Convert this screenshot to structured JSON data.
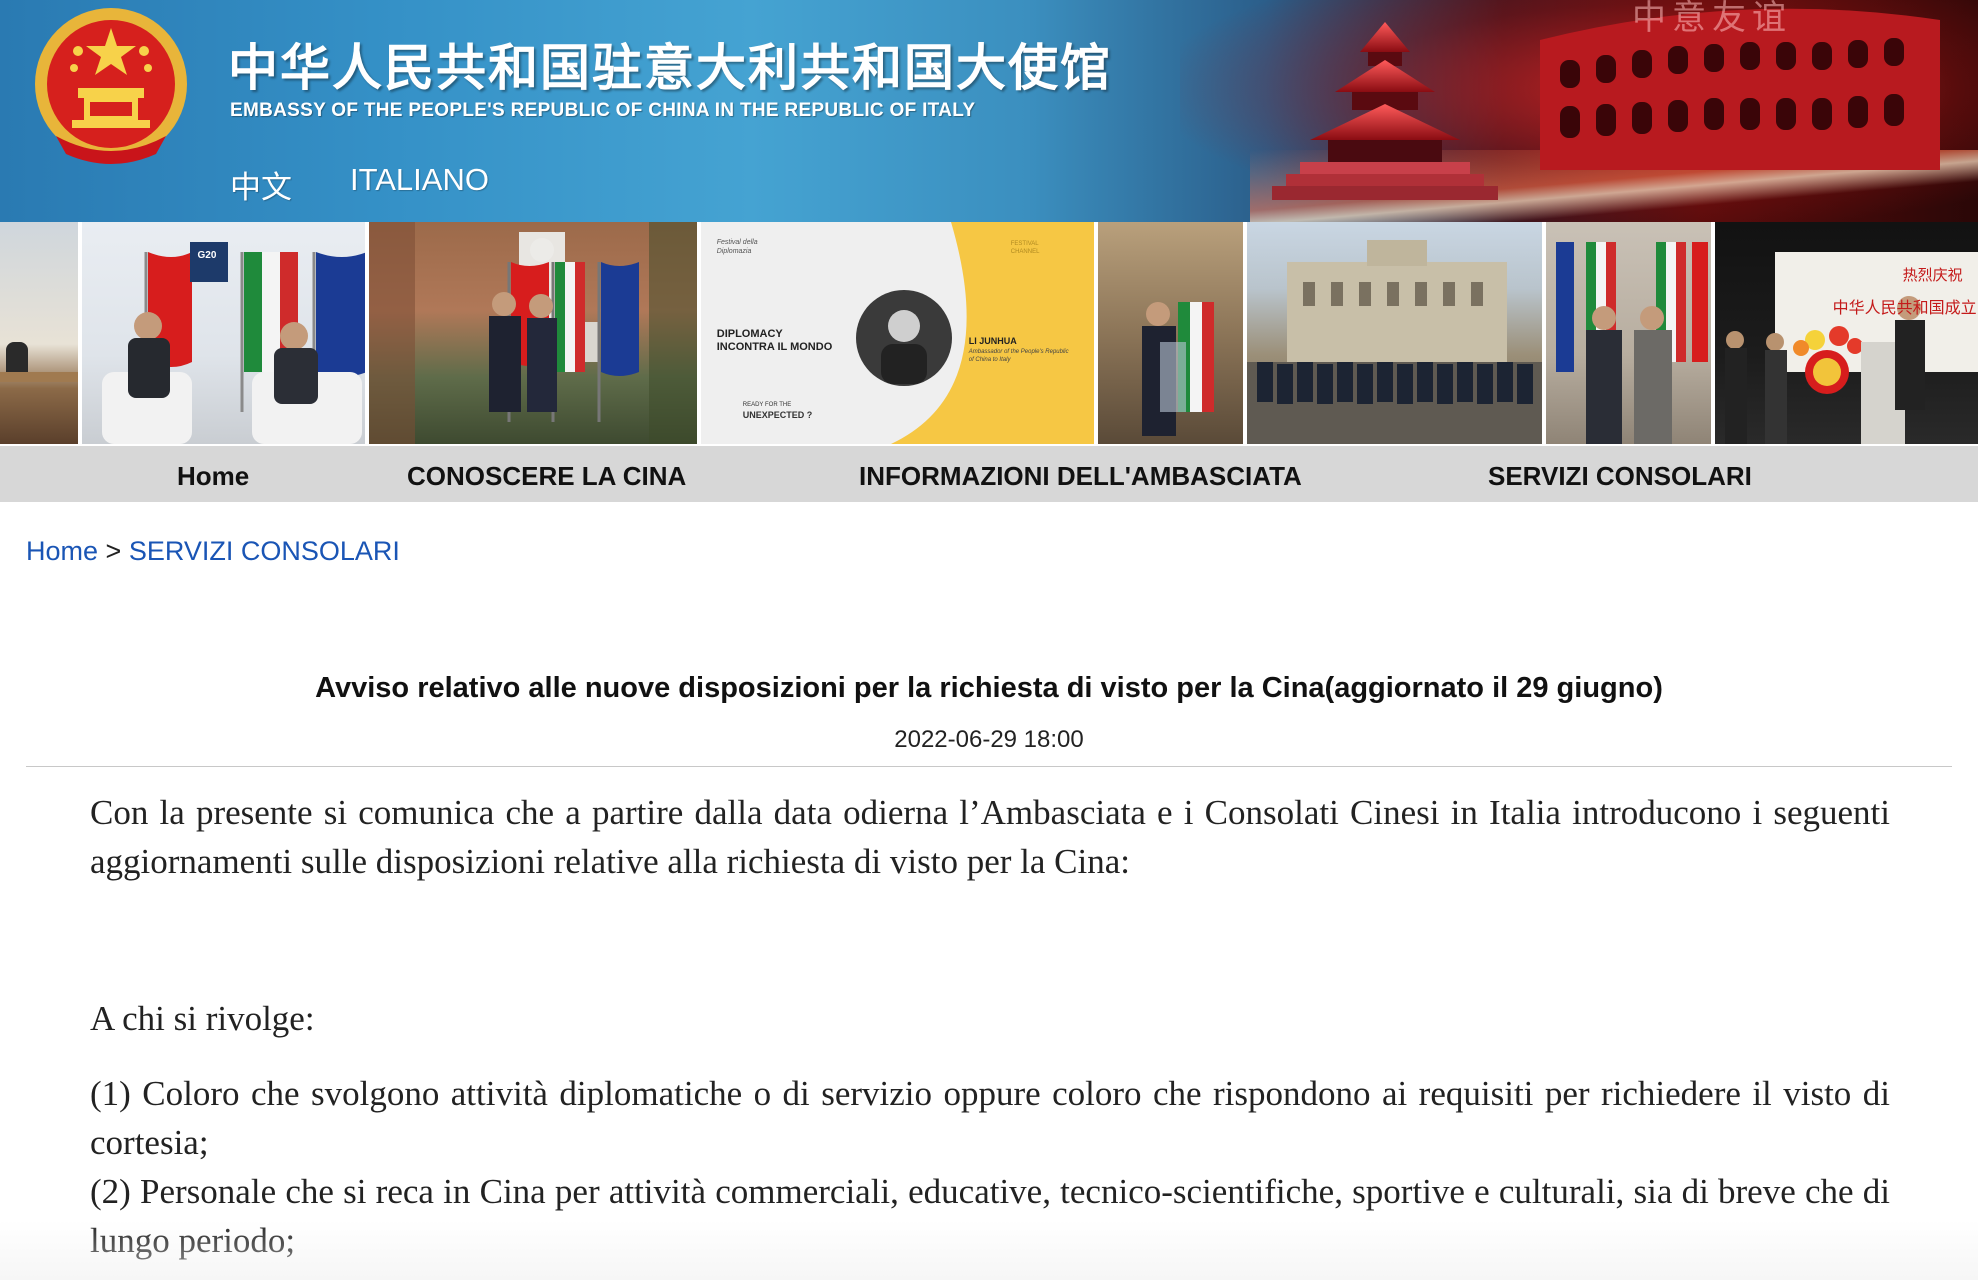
{
  "header": {
    "title_cn": "中华人民共和国驻意大利共和国大使馆",
    "title_en": "EMBASSY OF THE PEOPLE'S REPUBLIC OF CHINA IN THE REPUBLIC OF ITALY",
    "banner_overlay_text": "中意友谊",
    "languages": [
      "中文",
      "ITALIANO"
    ]
  },
  "photos": {
    "g20_badge": "G20",
    "festival_brand": "Festival della Diplomazia",
    "festival_tagline": "DIPLOMACY INCONTRA IL MONDO",
    "festival_speaker": "LI JUNHUA",
    "festival_speaker_role": "Ambassador of the People's Republic of China to Italy",
    "festival_ready_small": "READY FOR THE",
    "festival_ready": "UNEXPECTED ?",
    "festival_logo": "FESTIVAL CHANNEL",
    "ceremony_banner_1": "热烈庆祝",
    "ceremony_banner_2": "中华人民共和国成立"
  },
  "nav": {
    "items": [
      "Home",
      "CONOSCERE LA CINA",
      "INFORMAZIONI DELL'AMBASCIATA",
      "SERVIZI CONSOLARI"
    ]
  },
  "breadcrumb": {
    "home": "Home",
    "separator": ">",
    "current": "SERVIZI CONSOLARI"
  },
  "article": {
    "title": "Avviso relativo alle nuove disposizioni per la richiesta di visto per la Cina(aggiornato il 29 giugno)",
    "date": "2022-06-29 18:00",
    "intro": "Con la presente si comunica che a  partire dalla  data  odierna  l’Ambasciata e i Consolati Cinesi  in Italia introducono i  seguenti aggiornamenti  sulle disposizioni relative alla richiesta di visto per la Cina:",
    "audience_label": "A chi si rivolge:",
    "items": [
      "(1)  Coloro  che svolgono attività diplomatiche o di servizio oppure coloro che rispondono  ai  requisiti per richiedere il visto di cortesia;",
      "(2)  Personale  che si reca  in Cina per attività commerciali, educative, tecnico-scientifiche, sportive e culturali, sia di breve che di lungo periodo;"
    ]
  },
  "colors": {
    "nav_bg": "#d7d7d7",
    "link_blue": "#1a55b5",
    "banner_blue": "#3591c7",
    "banner_red": "#c41a1a"
  }
}
